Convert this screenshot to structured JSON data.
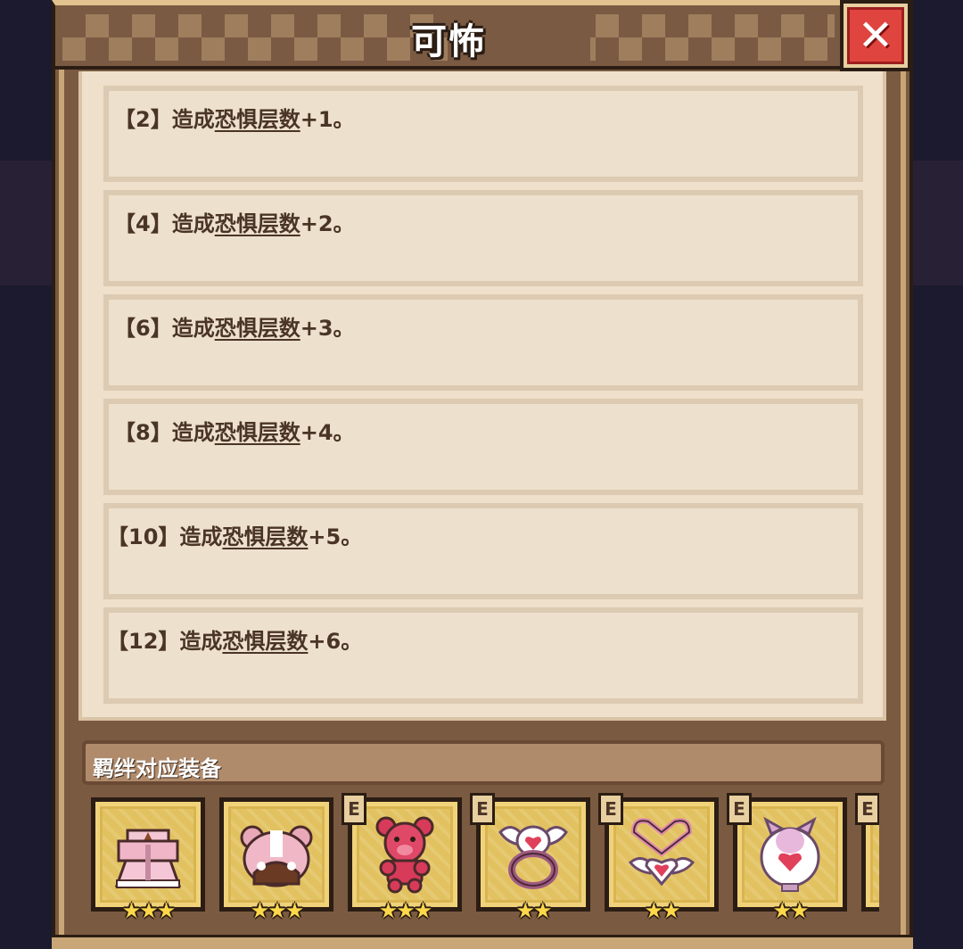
{
  "dialog": {
    "title": "可怖",
    "close_icon": "close-x-icon"
  },
  "bonus_entries": [
    {
      "tier": "【2】",
      "prefix": "造成",
      "keyword": "恐惧层数",
      "suffix": "+1。"
    },
    {
      "tier": "【4】",
      "prefix": "造成",
      "keyword": "恐惧层数",
      "suffix": "+2。"
    },
    {
      "tier": "【6】",
      "prefix": "造成",
      "keyword": "恐惧层数",
      "suffix": "+3。"
    },
    {
      "tier": "【8】",
      "prefix": "造成",
      "keyword": "恐惧层数",
      "suffix": "+4。"
    },
    {
      "tier": "【10】",
      "prefix": "造成",
      "keyword": "恐惧层数",
      "suffix": "+5。"
    },
    {
      "tier": "【12】",
      "prefix": "造成",
      "keyword": "恐惧层数",
      "suffix": "+6。"
    }
  ],
  "equipment": {
    "header": "羁绊对应装备",
    "items": [
      {
        "icon": "pink-dress-icon",
        "badge": "",
        "stars": "★★★"
      },
      {
        "icon": "bear-hood-icon",
        "badge": "",
        "stars": "★★★"
      },
      {
        "icon": "red-teddy-bear-icon",
        "badge": "E",
        "stars": "★★★"
      },
      {
        "icon": "winged-heart-ring-icon",
        "badge": "E",
        "stars": "★★"
      },
      {
        "icon": "heart-necklace-icon",
        "badge": "E",
        "stars": "★★"
      },
      {
        "icon": "heart-orb-icon",
        "badge": "E",
        "stars": "★★"
      },
      {
        "icon": "partial-item-icon",
        "badge": "E",
        "stars": ""
      }
    ]
  },
  "colors": {
    "panel": "#7a5a40",
    "parchment": "#efe0cb",
    "text": "#4a3426",
    "close_red": "#e0443e",
    "slot_gold": "#d9b552",
    "star_yellow": "#ffd84a"
  }
}
